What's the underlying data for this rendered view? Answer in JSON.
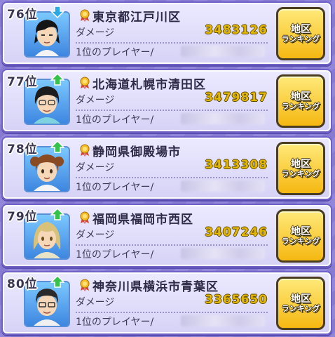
{
  "labels": {
    "damage": "ダメージ",
    "first_player": "1位のプレイヤー/",
    "button_line1": "地区",
    "button_line2": "ランキング"
  },
  "entries": [
    {
      "rank": "76位",
      "trend": "down",
      "region": "東京都江戸川区",
      "damage": "3483126",
      "avatar": "black-hair-boy-avatar"
    },
    {
      "rank": "77位",
      "trend": "up",
      "region": "北海道札幌市清田区",
      "damage": "3479817",
      "avatar": "glasses-girl-avatar"
    },
    {
      "rank": "78位",
      "trend": "up",
      "region": "静岡県御殿場市",
      "damage": "3413308",
      "avatar": "brown-hair-girl-avatar"
    },
    {
      "rank": "79位",
      "trend": "up",
      "region": "福岡県福岡市西区",
      "damage": "3407246",
      "avatar": "blonde-girl-avatar"
    },
    {
      "rank": "80位",
      "trend": "up",
      "region": "神奈川県横浜市青葉区",
      "damage": "3365650",
      "avatar": "glasses-boy-avatar"
    }
  ],
  "colors": {
    "trend_up": "#35c24a",
    "trend_down": "#2aa8e6",
    "score": "#e3b700",
    "button": "#f5b812"
  }
}
